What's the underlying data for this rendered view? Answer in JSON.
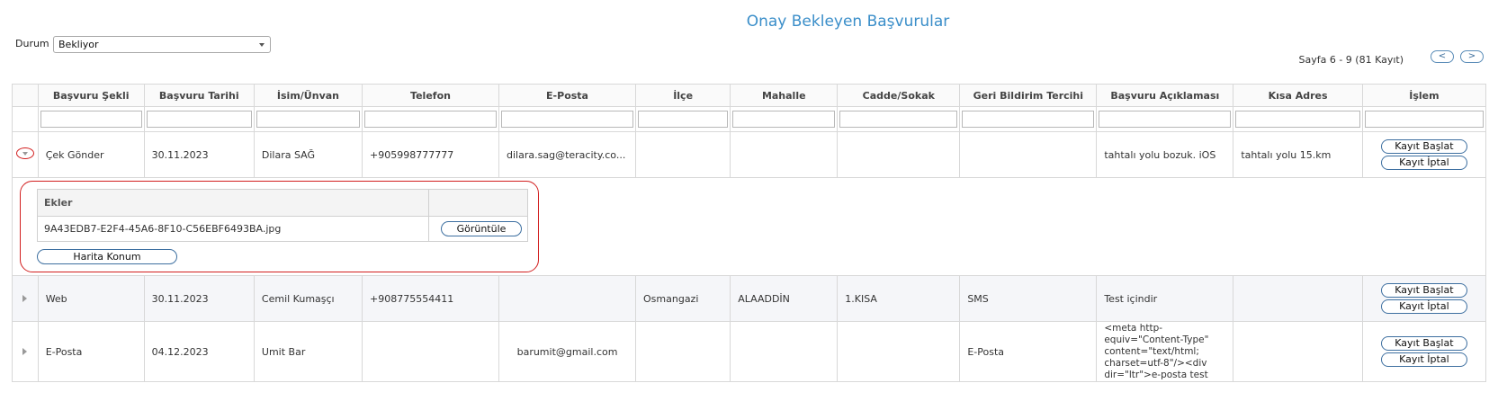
{
  "page": {
    "title": "Onay Bekleyen Başvurular"
  },
  "filter": {
    "label": "Durum",
    "selected": "Bekliyor"
  },
  "pager": {
    "info": "Sayfa 6 - 9 (81 Kayıt)",
    "prev": "<",
    "next": ">"
  },
  "columns": [
    "Başvuru Şekli",
    "Başvuru Tarihi",
    "İsim/Ünvan",
    "Telefon",
    "E-Posta",
    "İlçe",
    "Mahalle",
    "Cadde/Sokak",
    "Geri Bildirim Tercihi",
    "Başvuru Açıklaması",
    "Kısa Adres",
    "İşlem"
  ],
  "rows": [
    {
      "sekil": "Çek Gönder",
      "tarih": "30.11.2023",
      "isim": "Dilara SAĞ",
      "telefon": "+905998777777",
      "eposta": "dilara.sag@teracity.co...",
      "ilce": "",
      "mahalle": "",
      "cadde": "",
      "geri": "",
      "aciklama": "tahtalı yolu bozuk. iOS",
      "kisa": "tahtalı yolu 15.km"
    },
    {
      "sekil": "Web",
      "tarih": "30.11.2023",
      "isim": "Cemil Kumaşçı",
      "telefon": "+908775554411",
      "eposta": "",
      "ilce": "Osmangazi",
      "mahalle": "ALAADDİN",
      "cadde": "1.KISA",
      "geri": "SMS",
      "aciklama": "Test içindir",
      "kisa": ""
    },
    {
      "sekil": "E-Posta",
      "tarih": "04.12.2023",
      "isim": "Umit Bar",
      "telefon": "",
      "eposta": "barumit@gmail.com",
      "ilce": "",
      "mahalle": "",
      "cadde": "",
      "geri": "E-Posta",
      "aciklama": "<meta http-equiv=\"Content-Type\" content=\"text/html; charset=utf-8\"/><div dir=\"ltr\">e-posta test",
      "kisa": ""
    }
  ],
  "actions": {
    "start": "Kayıt Başlat",
    "cancel": "Kayıt İptal"
  },
  "detail": {
    "ekler_header": "Ekler",
    "file_name": "9A43EDB7-E2F4-45A6-8F10-C56EBF6493BA.jpg",
    "view_button": "Görüntüle",
    "map_button": "Harita Konum"
  }
}
